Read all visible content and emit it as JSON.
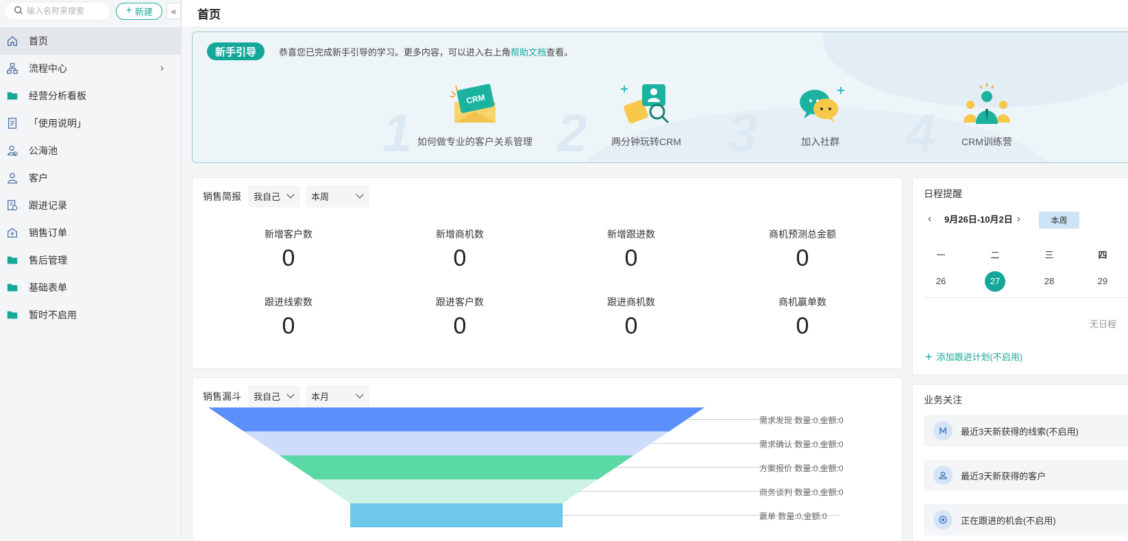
{
  "sidebar": {
    "search_placeholder": "输入名称来搜索",
    "new_button": "新建",
    "collapse_icon": "«",
    "items": [
      {
        "label": "首页",
        "icon": "home-icon"
      },
      {
        "label": "流程中心",
        "icon": "flow-icon"
      },
      {
        "label": "经营分析看板",
        "icon": "folder-icon"
      },
      {
        "label": "「使用说明」",
        "icon": "document-icon"
      },
      {
        "label": "公海池",
        "icon": "user-pool-icon"
      },
      {
        "label": "客户",
        "icon": "user-icon"
      },
      {
        "label": "跟进记录",
        "icon": "record-icon"
      },
      {
        "label": "销售订单",
        "icon": "order-icon"
      },
      {
        "label": "售后管理",
        "icon": "folder-icon"
      },
      {
        "label": "基础表单",
        "icon": "folder-icon"
      },
      {
        "label": "暂时不启用",
        "icon": "folder-icon"
      }
    ]
  },
  "header": {
    "title": "首页"
  },
  "guide": {
    "tag": "新手引导",
    "text_before": "恭喜您已完成新手引导的学习。更多内容，可以进入右上角",
    "link": "帮助文档",
    "text_after": "查看。",
    "cards": [
      {
        "label": "如何做专业的客户关系管理",
        "num": "1",
        "badge": "CRM"
      },
      {
        "label": "两分钟玩转CRM",
        "num": "2"
      },
      {
        "label": "加入社群",
        "num": "3"
      },
      {
        "label": "CRM训练营",
        "num": "4"
      }
    ]
  },
  "sales": {
    "title": "销售简报",
    "owner": "我自己",
    "period": "本周",
    "stats": [
      {
        "label": "新增客户数",
        "value": "0"
      },
      {
        "label": "新增商机数",
        "value": "0"
      },
      {
        "label": "新增跟进数",
        "value": "0"
      },
      {
        "label": "商机预测总金额",
        "value": "0"
      },
      {
        "label": "跟进线索数",
        "value": "0"
      },
      {
        "label": "跟进客户数",
        "value": "0"
      },
      {
        "label": "跟进商机数",
        "value": "0"
      },
      {
        "label": "商机赢单数",
        "value": "0"
      }
    ]
  },
  "funnel": {
    "title": "销售漏斗",
    "owner": "我自己",
    "period": "本月",
    "stages": [
      {
        "label": "需求发现 数量:0,金额:0",
        "color": "#5b8ff9"
      },
      {
        "label": "需求确认 数量:0,金额:0",
        "color": "#cddcfa"
      },
      {
        "label": "方案报价 数量:0,金额:0",
        "color": "#5ad8a6"
      },
      {
        "label": "商务谈判 数量:0,金额:0",
        "color": "#cdf3e4"
      },
      {
        "label": "赢单 数量:0,金额:0",
        "color": "#6dc8ec"
      }
    ]
  },
  "schedule": {
    "title": "日程提醒",
    "range": "9月26日-10月2日",
    "week_button": "本周",
    "weekdays": [
      "一",
      "二",
      "三",
      "四"
    ],
    "dates": [
      "26",
      "27",
      "28",
      "29"
    ],
    "empty": "无日程",
    "add_plan": "添加跟进计划(不启用)"
  },
  "focus": {
    "title": "业务关注",
    "items": [
      {
        "label": "最近3天新获得的线索(不启用)",
        "icon": "lead-icon"
      },
      {
        "label": "最近3天新获得的客户",
        "icon": "customer-icon"
      },
      {
        "label": "正在跟进的机会(不启用)",
        "icon": "opportunity-icon"
      }
    ]
  },
  "colors": {
    "accent": "#15a89a",
    "week_button_bg": "#cde3f7"
  }
}
